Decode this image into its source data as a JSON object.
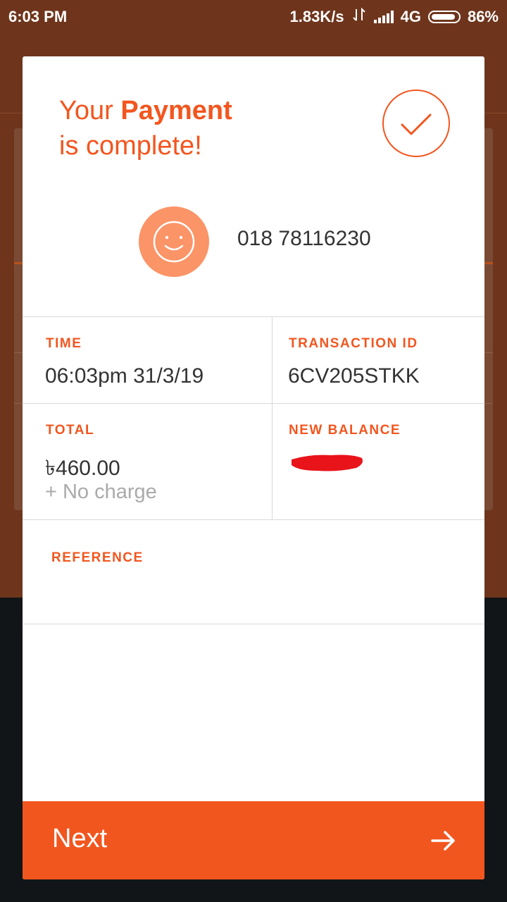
{
  "status_bar": {
    "time": "6:03 PM",
    "speed": "1.83K/s",
    "network": "4G",
    "battery": "86%"
  },
  "dialog": {
    "title_part1": "Your ",
    "title_bold": "Payment",
    "title_part2": "is complete!",
    "recipient_number": "018 78116230",
    "time_label": "TIME",
    "time_value": "06:03pm 31/3/19",
    "txn_label": "TRANSACTION ID",
    "txn_value": "6CV205STKK",
    "total_label": "TOTAL",
    "total_value": "৳460.00",
    "total_note": "+ No charge",
    "balance_label": "NEW BALANCE",
    "reference_label": "REFERENCE",
    "next_label": "Next"
  },
  "colors": {
    "accent": "#f2561f",
    "avatar_bg": "#fb9467",
    "redaction": "#e8141a"
  },
  "icons": [
    "check-icon",
    "smiley-icon",
    "arrow-right-icon"
  ]
}
